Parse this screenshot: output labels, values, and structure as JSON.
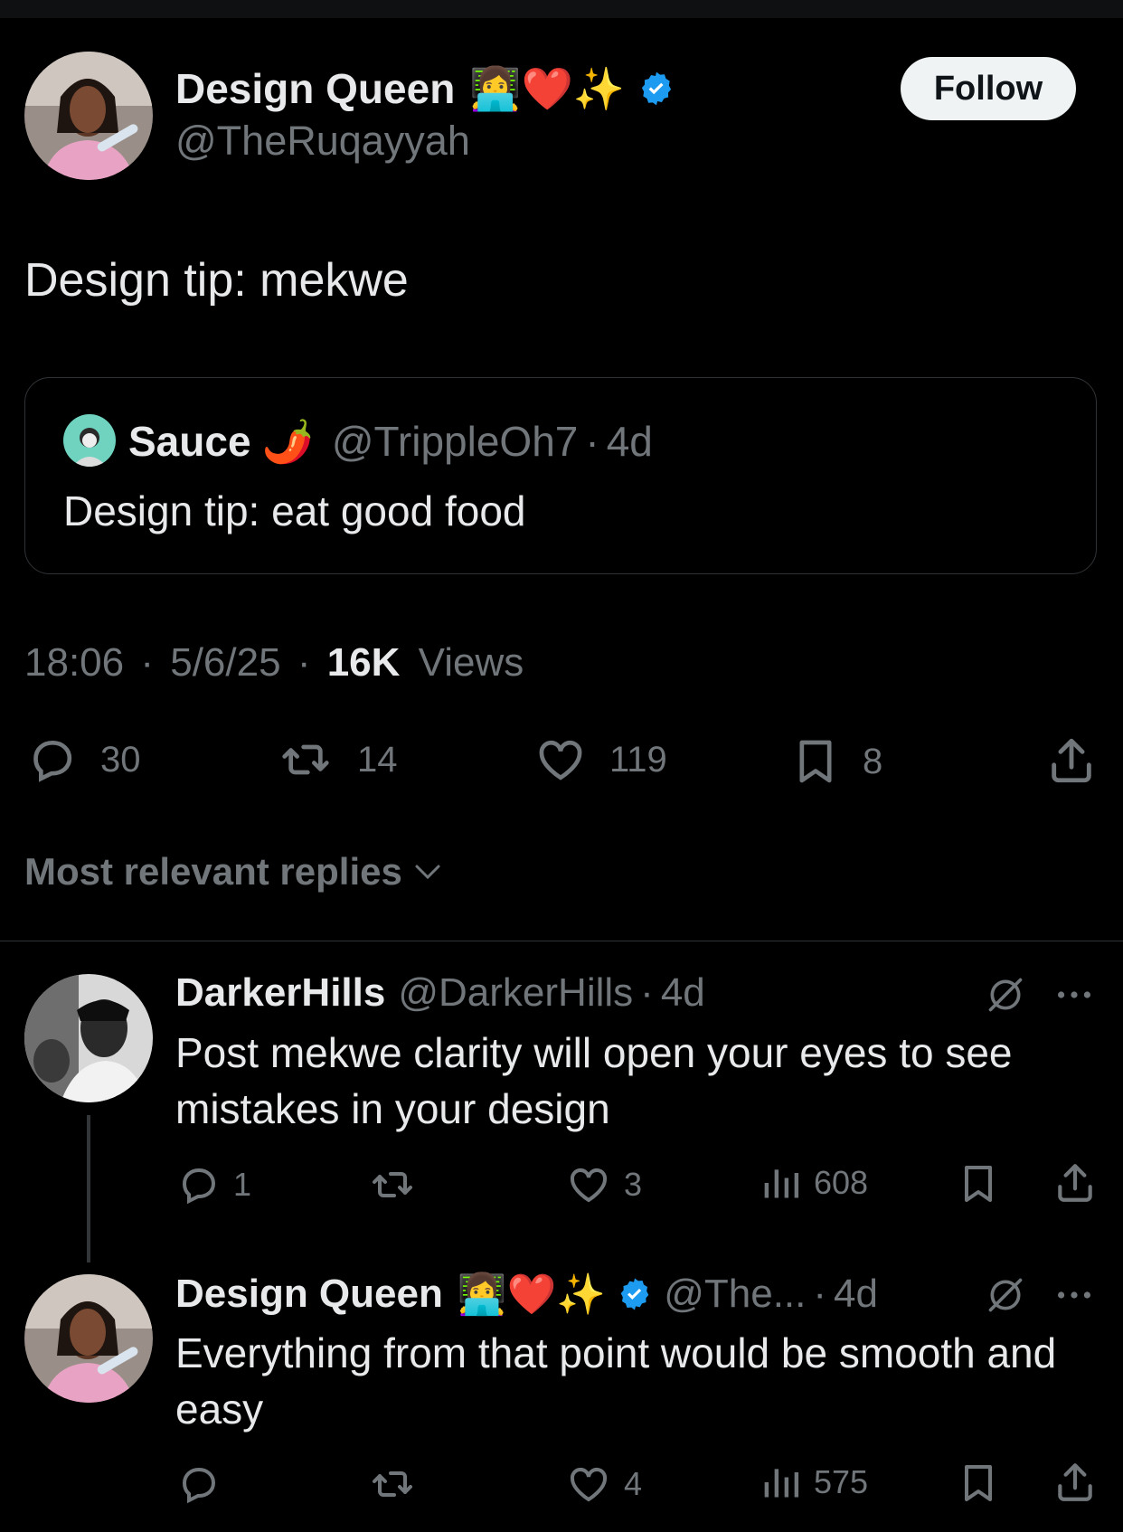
{
  "main_tweet": {
    "author_name": "Design Queen",
    "author_emojis": "👩‍💻❤️✨",
    "author_handle": "@TheRuqayyah",
    "follow_label": "Follow",
    "text": "Design tip: mekwe",
    "quote": {
      "author_name": "Sauce",
      "author_emoji": "🌶️",
      "author_handle": "@TrippleOh7",
      "separator": "·",
      "time": "4d",
      "text": "Design tip: eat good food"
    },
    "time": "18:06",
    "date": "5/6/25",
    "separator": "·",
    "views_count": "16K",
    "views_label": "Views",
    "actions": {
      "replies": "30",
      "reposts": "14",
      "likes": "119",
      "bookmarks": "8"
    }
  },
  "replies_sort_label": "Most relevant replies",
  "replies": [
    {
      "author_name": "DarkerHills",
      "author_handle": "@DarkerHills",
      "separator": "·",
      "time": "4d",
      "text": "Post mekwe clarity will open your eyes to see mistakes in your design",
      "actions": {
        "replies": "1",
        "reposts": "",
        "likes": "3",
        "views": "608"
      }
    },
    {
      "author_name": "Design Queen",
      "author_emojis": "👩‍💻❤️✨",
      "author_handle": "@The...",
      "separator": "·",
      "time": "4d",
      "text": "Everything from that point would be smooth and easy",
      "actions": {
        "replies": "",
        "reposts": "",
        "likes": "4",
        "views": "575"
      }
    }
  ],
  "colors": {
    "background": "#000000",
    "text_primary": "#e7e9ea",
    "text_secondary": "#71767b",
    "border": "#2f3336",
    "verified": "#1d9bf0",
    "follow_bg": "#eff3f4"
  },
  "icons": [
    "reply-icon",
    "repost-icon",
    "like-icon",
    "bookmark-icon",
    "share-icon",
    "views-icon",
    "verified-badge-icon",
    "grok-icon",
    "more-icon",
    "chevron-down-icon"
  ]
}
